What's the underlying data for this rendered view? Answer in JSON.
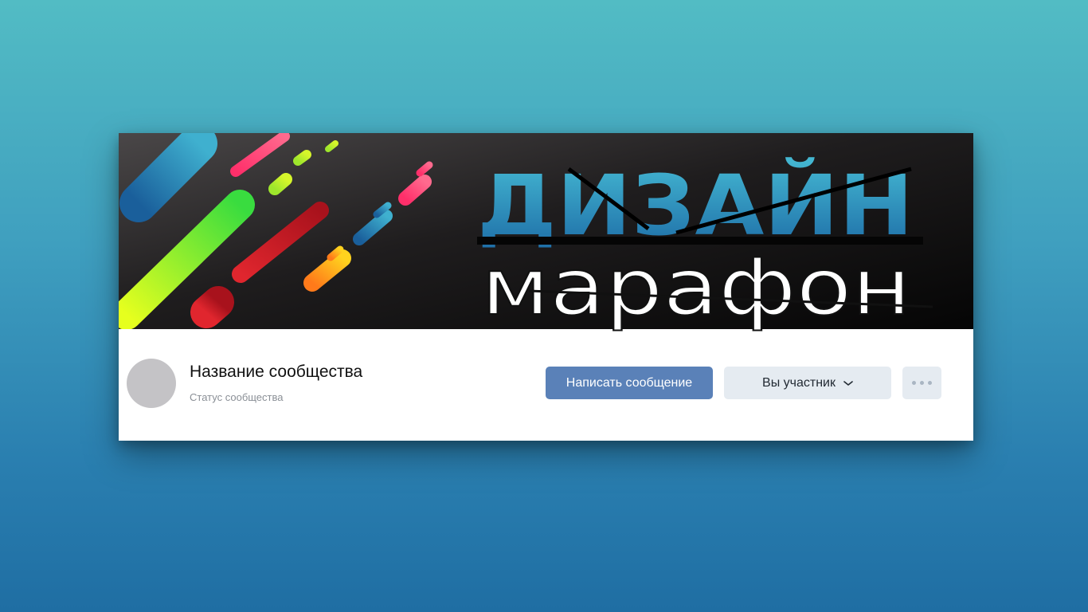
{
  "cover": {
    "title_top": "ДИЗАЙН",
    "title_bottom": "марафон",
    "colors": {
      "background": "#1a1819",
      "title_top_accent": "#3aa7c9",
      "title_bottom_accent": "#5fe03a"
    }
  },
  "community": {
    "name": "Название сообщества",
    "status": "Статус сообщества"
  },
  "actions": {
    "message_label": "Написать сообщение",
    "member_label": "Вы участник",
    "member_icon": "chevron-down-icon",
    "more_icon": "more-dots-icon"
  },
  "colors": {
    "primary_button": "#5a81b8",
    "secondary_button": "#e5ebf1"
  }
}
